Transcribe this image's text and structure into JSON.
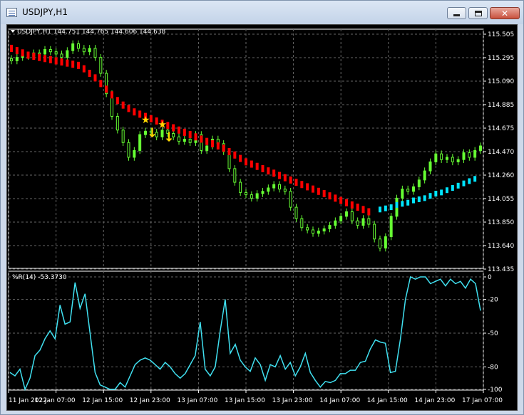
{
  "window": {
    "title": "USDJPY,H1",
    "buttons": {
      "minimize": "minimize-icon",
      "maximize": "maximize-icon",
      "close": "close-icon"
    }
  },
  "main_chart": {
    "header": "USDJPY,H1  144.751 144.765 144.606 144.638",
    "price_labels": [
      "115.505",
      "115.295",
      "115.090",
      "114.885",
      "114.675",
      "114.470",
      "114.260",
      "114.055",
      "113.850",
      "113.640",
      "113.435"
    ],
    "markers": {
      "star": "★",
      "arrow": "↓"
    }
  },
  "indicator": {
    "label": "%R(14) -53.3730",
    "levels": [
      "0",
      "-20",
      "-50",
      "-80",
      "-100"
    ]
  },
  "time_labels": [
    "11 Jan 2022",
    "12 Jan 07:00",
    "12 Jan 15:00",
    "12 Jan 23:00",
    "13 Jan 07:00",
    "13 Jan 15:00",
    "13 Jan 23:00",
    "14 Jan 07:00",
    "14 Jan 15:00",
    "14 Jan 23:00",
    "17 Jan 07:00"
  ],
  "colors": {
    "background": "#000000",
    "grid": "#666666",
    "bull_candle": "#66ff33",
    "band_down": "#ff0000",
    "band_up": "#00e5ff",
    "marker": "#ffd700",
    "wpr_line": "#40e0f0",
    "axis_text": "#ffffff"
  },
  "chart_data": [
    {
      "type": "candlestick",
      "symbol": "USDJPY",
      "timeframe": "H1",
      "ylim": [
        113.435,
        115.505
      ],
      "close": [
        115.27,
        115.3,
        115.32,
        115.31,
        115.34,
        115.33,
        115.37,
        115.35,
        115.33,
        115.3,
        115.36,
        115.42,
        115.38,
        115.35,
        115.38,
        115.3,
        115.16,
        114.98,
        114.78,
        114.66,
        114.55,
        114.42,
        114.48,
        114.62,
        114.65,
        114.64,
        114.6,
        114.66,
        114.63,
        114.6,
        114.56,
        114.58,
        114.55,
        114.62,
        114.48,
        114.52,
        114.58,
        114.54,
        114.47,
        114.32,
        114.2,
        114.11,
        114.09,
        114.06,
        114.1,
        114.12,
        114.15,
        114.18,
        114.14,
        114.12,
        113.98,
        113.88,
        113.8,
        113.78,
        113.75,
        113.77,
        113.79,
        113.82,
        113.86,
        113.9,
        113.94,
        113.86,
        113.82,
        113.88,
        113.83,
        113.7,
        113.62,
        113.72,
        113.9,
        114.06,
        114.14,
        114.12,
        114.16,
        114.22,
        114.3,
        114.38,
        114.45,
        114.4,
        114.42,
        114.38,
        114.4,
        114.46,
        114.42,
        114.48,
        114.52
      ],
      "band_red": [
        115.38,
        115.36,
        115.34,
        115.32,
        115.31,
        115.3,
        115.29,
        115.28,
        115.27,
        115.26,
        115.25,
        115.24,
        115.23,
        115.2,
        115.16,
        115.12,
        115.07,
        115.02,
        114.97,
        114.92,
        114.88,
        114.85,
        114.82,
        114.8,
        114.78,
        114.76,
        114.74,
        114.72,
        114.7,
        114.68,
        114.66,
        114.64,
        114.62,
        114.6,
        114.58,
        114.56,
        114.54,
        114.52,
        114.5,
        114.47,
        114.44,
        114.41,
        114.38,
        114.36,
        114.34,
        114.32,
        114.3,
        114.28,
        114.26,
        114.24,
        114.22,
        114.2,
        114.18,
        114.16,
        114.14,
        114.12,
        114.1,
        114.08,
        114.06,
        114.04,
        114.02,
        114.0,
        113.98,
        113.96,
        113.94
      ],
      "band_cyan_start_index": 66,
      "band_cyan": [
        113.96,
        113.97,
        113.98,
        114.0,
        114.01,
        114.02,
        114.04,
        114.05,
        114.06,
        114.08,
        114.1,
        114.11,
        114.13,
        114.15,
        114.17,
        114.19,
        114.21,
        114.23
      ]
    },
    {
      "type": "line",
      "name": "%R(14)",
      "ylim": [
        -100,
        0
      ],
      "values": [
        -85,
        -88,
        -82,
        -100,
        -90,
        -70,
        -65,
        -55,
        -48,
        -55,
        -25,
        -42,
        -40,
        -5,
        -28,
        -15,
        -50,
        -85,
        -96,
        -98,
        -100,
        -100,
        -94,
        -98,
        -88,
        -78,
        -74,
        -72,
        -74,
        -78,
        -82,
        -76,
        -80,
        -86,
        -90,
        -86,
        -78,
        -70,
        -40,
        -82,
        -88,
        -80,
        -48,
        -20,
        -68,
        -60,
        -74,
        -80,
        -84,
        -72,
        -78,
        -92,
        -78,
        -80,
        -70,
        -82,
        -76,
        -88,
        -80,
        -68,
        -85,
        -92,
        -98,
        -93,
        -94,
        -92,
        -86,
        -86,
        -83,
        -83,
        -76,
        -75,
        -64,
        -56,
        -58,
        -59,
        -85,
        -84,
        -55,
        -20,
        0,
        -2,
        0,
        0,
        -6,
        -4,
        -2,
        -8,
        -2,
        -6,
        -4,
        -10,
        -2,
        -6,
        -30
      ]
    }
  ]
}
